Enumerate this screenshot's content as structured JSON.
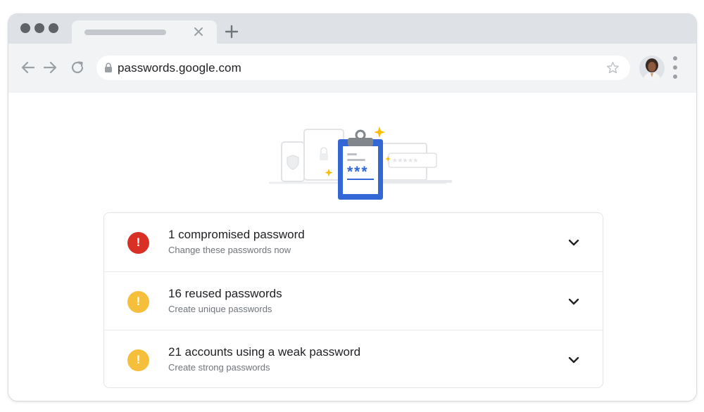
{
  "browser": {
    "window_controls": [
      "red",
      "yellow",
      "green"
    ],
    "tab": {
      "title": "",
      "close_icon": "close-icon"
    },
    "new_tab_icon": "plus-icon",
    "nav": {
      "back_icon": "arrow-left-icon",
      "forward_icon": "arrow-right-icon",
      "reload_icon": "reload-icon"
    },
    "address_bar": {
      "url": "passwords.google.com",
      "lock_icon": "lock-icon",
      "bookmark_icon": "star-icon"
    },
    "profile_avatar": "avatar",
    "menu_icon": "more-vert-icon"
  },
  "hero": {
    "illustration": "password-checkup-clipboard",
    "masked_password": "***",
    "masked_field": "*****"
  },
  "checkup": {
    "items": [
      {
        "title": "1 compromised password",
        "subtitle": "Change these passwords now",
        "severity": "critical",
        "color": "#d93025"
      },
      {
        "title": "16 reused passwords",
        "subtitle": "Create unique passwords",
        "severity": "warning",
        "color": "#f6bf3b"
      },
      {
        "title": "21 accounts using a weak password",
        "subtitle": "Create strong passwords",
        "severity": "warning",
        "color": "#f6bf3b"
      }
    ],
    "icon_glyph": "!",
    "expand_icon": "chevron-down-icon"
  },
  "colors": {
    "accent_blue": "#3367d6",
    "spark_yellow": "#fbbc04",
    "chrome_frame": "#dee1e6",
    "toolbar": "#f1f3f4"
  }
}
